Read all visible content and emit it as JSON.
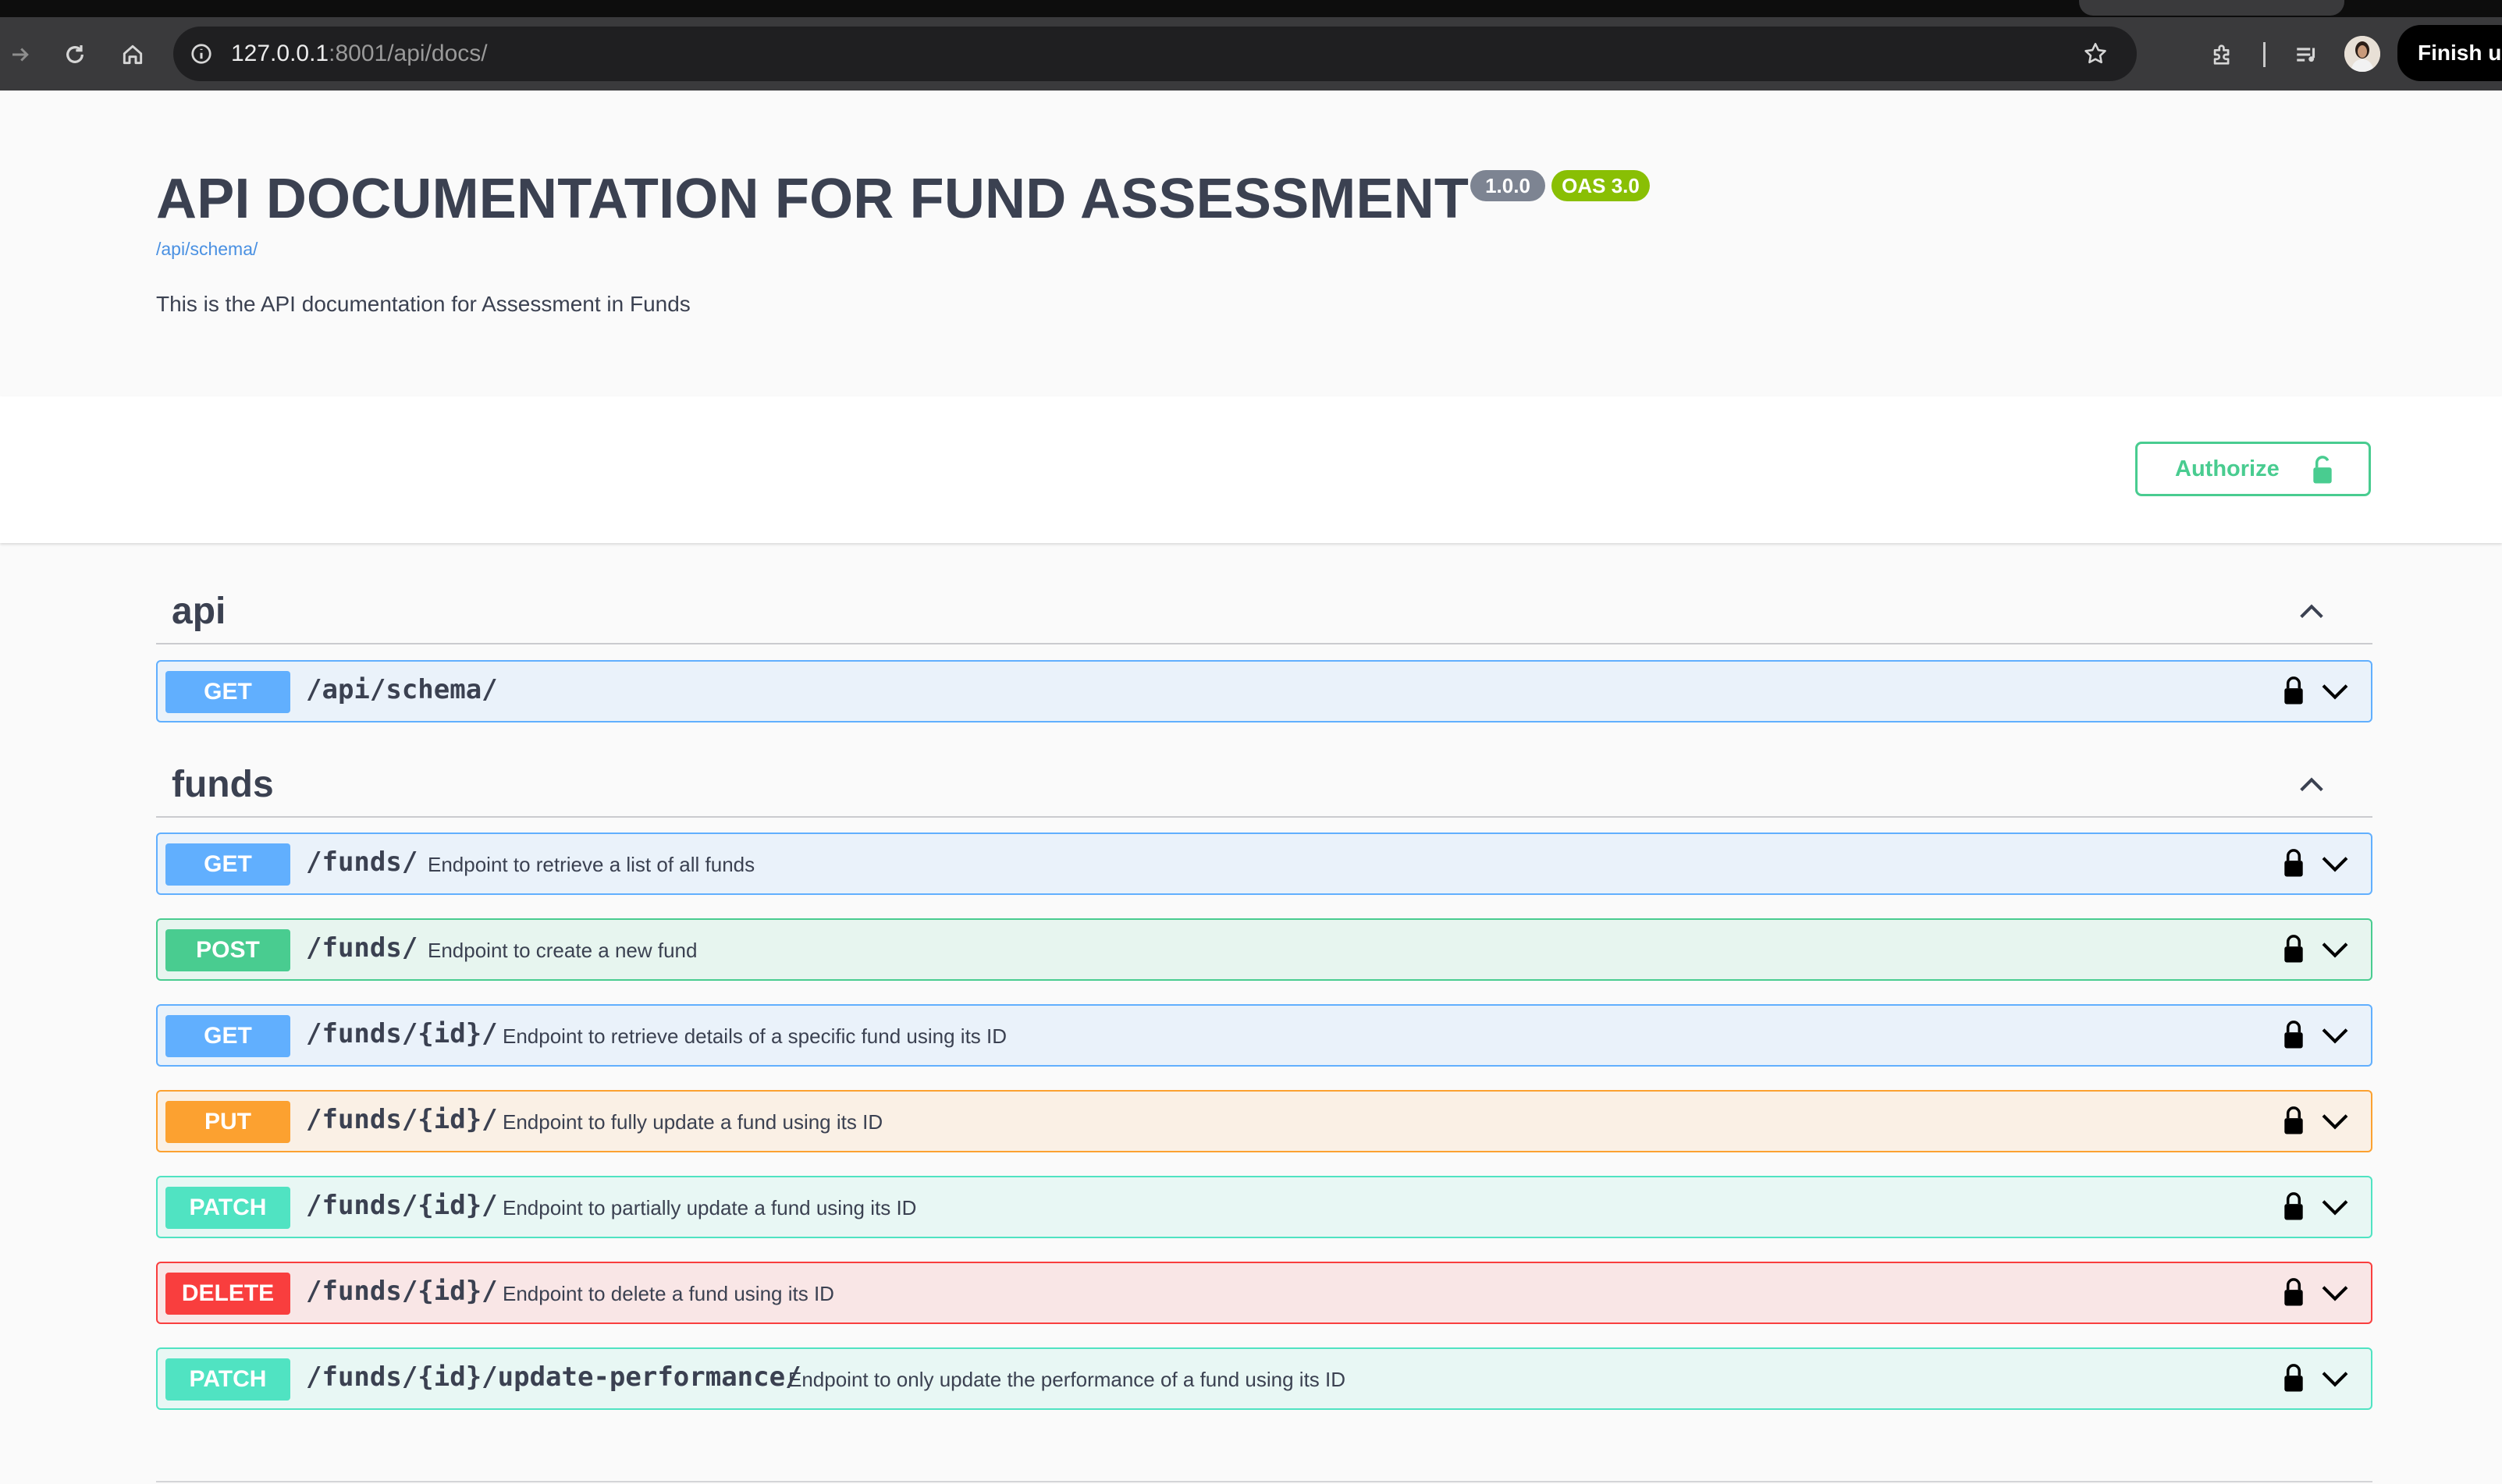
{
  "browser": {
    "url_host": "127.0.0.1",
    "url_rest": ":8001/api/docs/",
    "finish_button": "Finish up"
  },
  "info": {
    "title": "API DOCUMENTATION FOR FUND ASSESSMENT",
    "version_badge": "1.0.0",
    "oas_badge": "OAS 3.0",
    "schema_link": "/api/schema/",
    "description": "This is the API documentation for Assessment in Funds"
  },
  "authorize": {
    "label": "Authorize"
  },
  "groups": [
    {
      "name": "api",
      "operations": [
        {
          "method": "GET",
          "path": "/api/schema/",
          "summary": ""
        }
      ]
    },
    {
      "name": "funds",
      "operations": [
        {
          "method": "GET",
          "path": "/funds/",
          "summary": "Endpoint to retrieve a list of all funds"
        },
        {
          "method": "POST",
          "path": "/funds/",
          "summary": "Endpoint to create a new fund"
        },
        {
          "method": "GET",
          "path": "/funds/{id}/",
          "summary": "Endpoint to retrieve details of a specific fund using its ID"
        },
        {
          "method": "PUT",
          "path": "/funds/{id}/",
          "summary": "Endpoint to fully update a fund using its ID"
        },
        {
          "method": "PATCH",
          "path": "/funds/{id}/",
          "summary": "Endpoint to partially update a fund using its ID"
        },
        {
          "method": "DELETE",
          "path": "/funds/{id}/",
          "summary": "Endpoint to delete a fund using its ID"
        },
        {
          "method": "PATCH",
          "path": "/funds/{id}/update-performance/",
          "summary": "Endpoint to only update the performance of a fund using its ID"
        }
      ]
    }
  ],
  "colors": {
    "get": "#61affe",
    "post": "#49cc90",
    "put": "#fca130",
    "patch": "#50e3c2",
    "delete": "#f93e3e",
    "authorize": "#49cc90"
  },
  "icons": [
    "back-arrow-icon",
    "reload-icon",
    "home-icon",
    "info-icon",
    "star-icon",
    "extensions-icon",
    "media-queue-icon",
    "lock-icon",
    "chevron-up-icon",
    "chevron-down-icon",
    "unlock-icon"
  ]
}
